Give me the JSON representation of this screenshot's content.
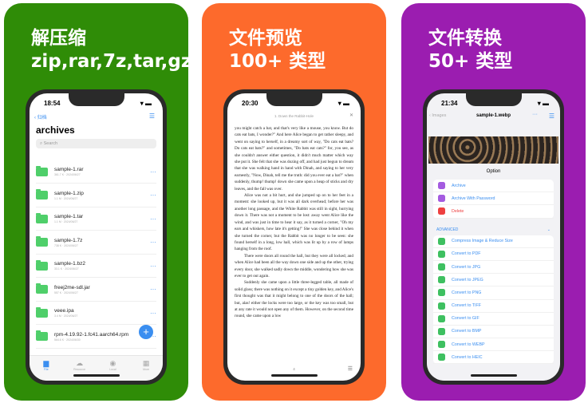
{
  "panels": [
    {
      "title1": "解压缩",
      "title2": "zip,rar,7z,tar,gz",
      "bg": "#2f8c07"
    },
    {
      "title1": "文件预览",
      "title2": "100+ 类型",
      "bg": "#fd6a2c"
    },
    {
      "title1": "文件转换",
      "title2": "50+ 类型",
      "bg": "#9b1db0"
    }
  ],
  "archive_app": {
    "time": "18:54",
    "back": "归档",
    "title": "archives",
    "search_placeholder": "Search",
    "files": [
      {
        "name": "sample-1.rar",
        "meta": "361.7 K · 2024/06/27"
      },
      {
        "name": "sample-1.zip",
        "meta": "1.1 M · 2024/06/27"
      },
      {
        "name": "sample-1.tar",
        "meta": "1.1 M · 2024/06/27"
      },
      {
        "name": "sample-1.7z",
        "meta": "738 K · 2024/06/27"
      },
      {
        "name": "sample-1.bz2",
        "meta": "33.1 K · 2024/06/27"
      },
      {
        "name": "freej2me-sdl.jar",
        "meta": "557 K · 2024/06/27"
      },
      {
        "name": "veee.ipa",
        "meta": "3.4 M · 2024/06/27"
      },
      {
        "name": "rpm-4.19.92-1.fc41.aarch64.rpm",
        "meta": "564.6 K · 2024/06/30"
      }
    ],
    "tabs": [
      {
        "label": "File",
        "icon": "folder-icon",
        "active": true
      },
      {
        "label": "Resource",
        "icon": "cloud-icon"
      },
      {
        "label": "Local",
        "icon": "disc-icon"
      },
      {
        "label": "More",
        "icon": "grid-icon"
      }
    ],
    "accent": "#3a8ef0"
  },
  "reader_app": {
    "time": "20:30",
    "chapter": "1. Down the Rabbit-Hole",
    "page": "4",
    "paragraphs": [
      "you might catch a bat, and that's very like a mouse, you know. But do cats eat bats, I wonder?\" And here Alice began to get rather sleepy, and went on saying to herself, in a dreamy sort of way, \"Do cats eat bats? Do cats eat bats?\" and sometimes, \"Do bats eat cats?\" for, you see, as she couldn't answer either question, it didn't much matter which way she put it. She felt that she was dozing off, and had just begun to dream that she was walking hand in hand with Dinah, and saying to her very earnestly, \"Now, Dinah, tell me the truth: did you ever eat a bat?\" when suddenly, thump! thump! down she came upon a heap of sticks and dry leaves, and the fall was over.",
      "Alice was not a bit hurt, and she jumped up on to her feet in a moment: she looked up, but it was all dark overhead; before her was another long passage, and the White Rabbit was still in sight, hurrying down it. There was not a moment to be lost: away went Alice like the wind, and was just in time to hear it say, as it turned a corner, \"Oh my ears and whiskers, how late it's getting!\" She was close behind it when she turned the corner, but the Rabbit was no longer to be seen: she found herself in a long, low hall, which was lit up by a row of lamps hanging from the roof.",
      "There were doors all round the hall, but they were all locked; and when Alice had been all the way down one side and up the other, trying every door, she walked sadly down the middle, wondering how she was ever to get out again.",
      "Suddenly she came upon a little three-legged table, all made of solid glass; there was nothing on it except a tiny golden key, and Alice's first thought was that it might belong to one of the doors of the hall; but, alas! either the locks were too large, or the key was too small, but at any rate it would not open any of them. However, on the second time round, she came upon a low"
    ]
  },
  "convert_app": {
    "time": "21:34",
    "back": "Images",
    "title": "sample-1.webp",
    "sheet_title": "Option",
    "actions": [
      {
        "label": "Archive",
        "color": "#a45be0"
      },
      {
        "label": "Archive With Password",
        "color": "#a45be0"
      },
      {
        "label": "Delete",
        "color": "#ee4040"
      }
    ],
    "section": "ADVANCED",
    "conversions": [
      "Compress Image & Reduce Size",
      "Convert to PDF",
      "Convert to JPG",
      "Convert to JPEG",
      "Convert to PNG",
      "Convert to TIFF",
      "Convert to GIF",
      "Convert to BMP",
      "Convert to WEBP",
      "Convert to HEIC"
    ],
    "convert_icon_color": "#3ec060",
    "delete_color": "#ee4040"
  }
}
